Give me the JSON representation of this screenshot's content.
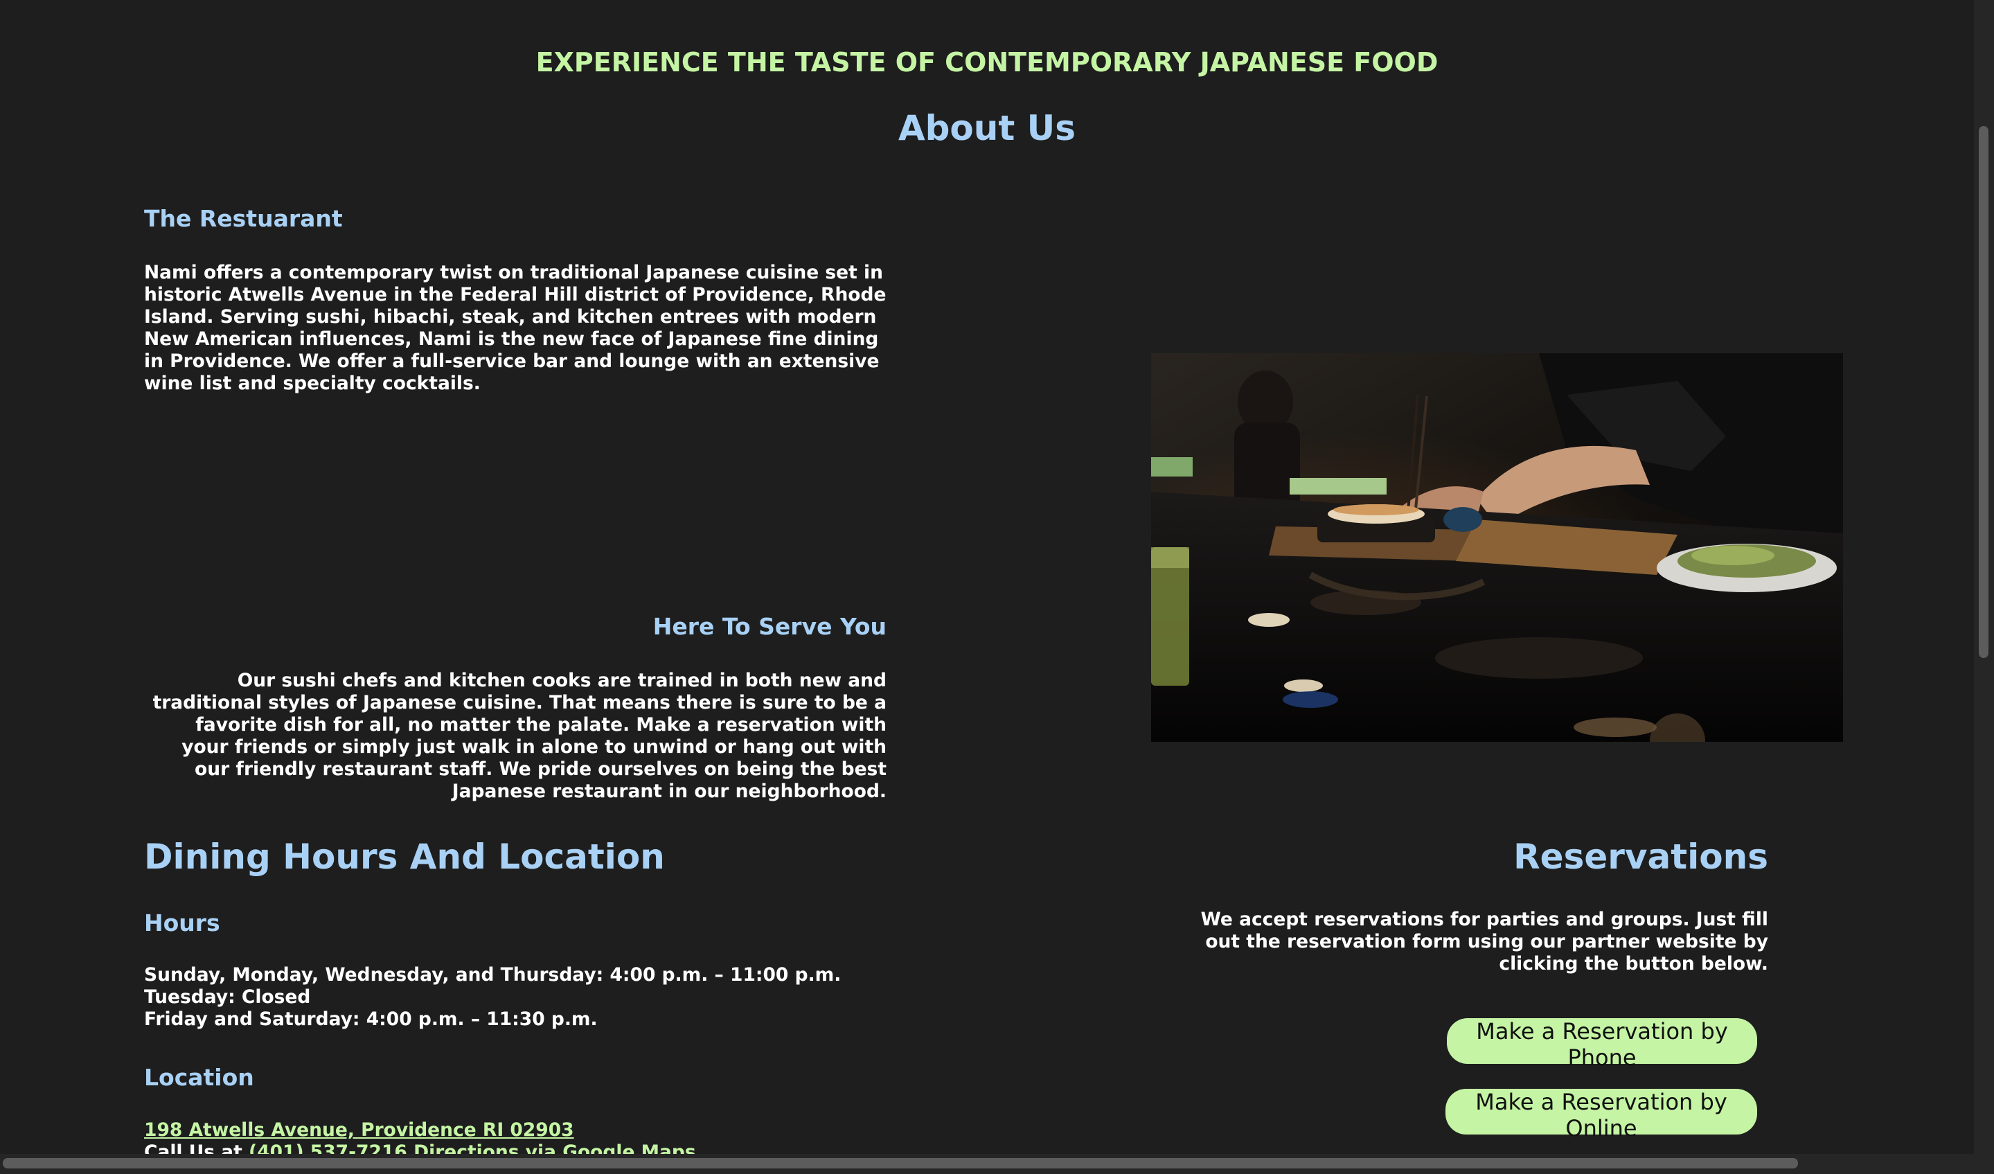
{
  "header": {
    "tagline": "EXPERIENCE THE TASTE OF CONTEMPORARY JAPANESE FOOD",
    "title": "About Us"
  },
  "restaurant": {
    "heading": "The Restuarant",
    "paragraph": "Nami offers a contemporary twist on traditional Japanese cuisine set in historic Atwells Avenue in the Federal Hill district of Providence, Rhode Island. Serving sushi, hibachi, steak, and kitchen entrees with modern New American influences, Nami is the new face of Japanese fine dining in Providence. We offer a full-service bar and lounge with an extensive wine list and specialty cocktails."
  },
  "serve": {
    "heading": "Here To Serve You",
    "paragraph": "Our sushi chefs and kitchen cooks are trained in both new and traditional styles of Japanese cuisine. That means there is sure to be a favorite dish for all, no matter the palate. Make a reservation with your friends or simply just walk in alone to unwind or hang out with our friendly restaurant staff. We pride ourselves on being the best Japanese restaurant in our neighborhood."
  },
  "dining": {
    "heading": "Dining Hours And Location",
    "hours_heading": "Hours",
    "hours": [
      "Sunday, Monday, Wednesday, and Thursday: 4:00 p.m. – 11:00 p.m.",
      "Tuesday: Closed",
      "Friday and Saturday: 4:00 p.m. – 11:30 p.m."
    ],
    "location_heading": "Location",
    "address": "198 Atwells Avenue, Providence RI 02903",
    "call_prefix": "Call Us at",
    "phone": "(401) 537-7216",
    "directions": "Directions via Google Maps"
  },
  "reservations": {
    "heading": "Reservations",
    "paragraph": "We accept reservations for parties and groups. Just fill out the reservation form using our partner website by clicking the button below.",
    "phone_button": "Make a Reservation by Phone",
    "online_button": "Make a Reservation by Online"
  },
  "colors": {
    "background": "#1e1e1e",
    "accent_green": "#c5f5a4",
    "heading_blue": "#a9d1f5",
    "text": "#ffffff"
  }
}
